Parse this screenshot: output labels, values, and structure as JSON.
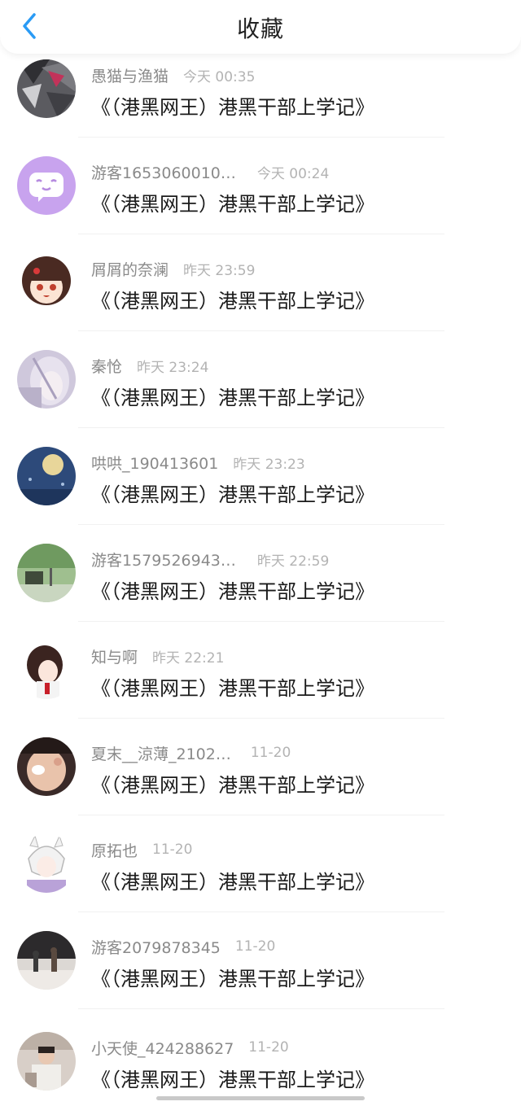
{
  "header": {
    "title": "收藏",
    "back_icon": "chevron-left-icon",
    "accent": "#2a9bf5"
  },
  "items": [
    {
      "name": "愚猫与渔猫",
      "time": "今天 00:35",
      "title": "《（港黑网王）港黑干部上学记》"
    },
    {
      "name": "游客1653060010…",
      "time": "今天 00:24",
      "title": "《（港黑网王）港黑干部上学记》"
    },
    {
      "name": "屑屑的奈澜",
      "time": "昨天 23:59",
      "title": "《（港黑网王）港黑干部上学记》"
    },
    {
      "name": "秦怆",
      "time": "昨天 23:24",
      "title": "《（港黑网王）港黑干部上学记》"
    },
    {
      "name": "哄哄_190413601",
      "time": "昨天 23:23",
      "title": "《（港黑网王）港黑干部上学记》"
    },
    {
      "name": "游客1579526943…",
      "time": "昨天 22:59",
      "title": "《（港黑网王）港黑干部上学记》"
    },
    {
      "name": "知与啊",
      "time": "昨天 22:21",
      "title": "《（港黑网王）港黑干部上学记》"
    },
    {
      "name": "夏末__涼薄_2102…",
      "time": "11-20",
      "title": "《（港黑网王）港黑干部上学记》"
    },
    {
      "name": "原拓也",
      "time": "11-20",
      "title": "《（港黑网王）港黑干部上学记》"
    },
    {
      "name": "游客2079878345",
      "time": "11-20",
      "title": "《（港黑网王）港黑干部上学记》"
    },
    {
      "name": "小天使_424288627",
      "time": "11-20",
      "title": "《（港黑网王）港黑干部上学记》"
    }
  ]
}
